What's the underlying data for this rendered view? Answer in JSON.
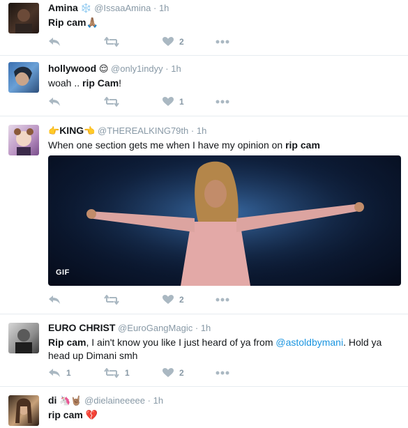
{
  "tweets": [
    {
      "display_name": "Amina",
      "emoji": "❄️",
      "handle": "@IssaaAmina",
      "dot": "·",
      "time": "1h",
      "text_bold": "Rip cam",
      "text_rest": "🙏🏽",
      "reply_count": "",
      "retweet_count": "",
      "like_count": "2"
    },
    {
      "display_name": "hollywood",
      "emoji": "😌",
      "handle": "@only1indyy",
      "dot": "·",
      "time": "1h",
      "text_pre": "woah .. ",
      "text_bold": "rip Cam",
      "text_post": "!",
      "like_count": "1"
    },
    {
      "display_name_prefix": "👉",
      "display_name": "KING",
      "display_name_suffix": "👈",
      "handle": "@THEREALKING79th",
      "dot": "·",
      "time": "1h",
      "text_pre": "When one section gets me when I have my opinion on ",
      "text_bold": "rip cam",
      "gif_label": "GIF",
      "like_count": "2"
    },
    {
      "display_name": "EURO CHRIST",
      "handle": "@EuroGangMagic",
      "dot": "·",
      "time": "1h",
      "text_bold": "Rip cam",
      "text_mid": ", I ain't know you like I just heard of ya from ",
      "mention": "@astoldbymani",
      "text_post": ". Hold ya head up Dimani smh",
      "reply_count": "1",
      "retweet_count": "1",
      "like_count": "2"
    },
    {
      "display_name": "di",
      "emoji": "🦄🤘🏽",
      "handle": "@dielaineeeee",
      "dot": "·",
      "time": "1h",
      "text_bold": "rip cam",
      "text_post": " 💔"
    }
  ],
  "icons": {
    "reply": "reply-icon",
    "retweet": "retweet-icon",
    "like": "heart-icon",
    "more": "more-icon"
  },
  "colors": {
    "action_gray": "#aab8c2",
    "link_blue": "#1b95e0",
    "divider": "#e6ecf0"
  }
}
